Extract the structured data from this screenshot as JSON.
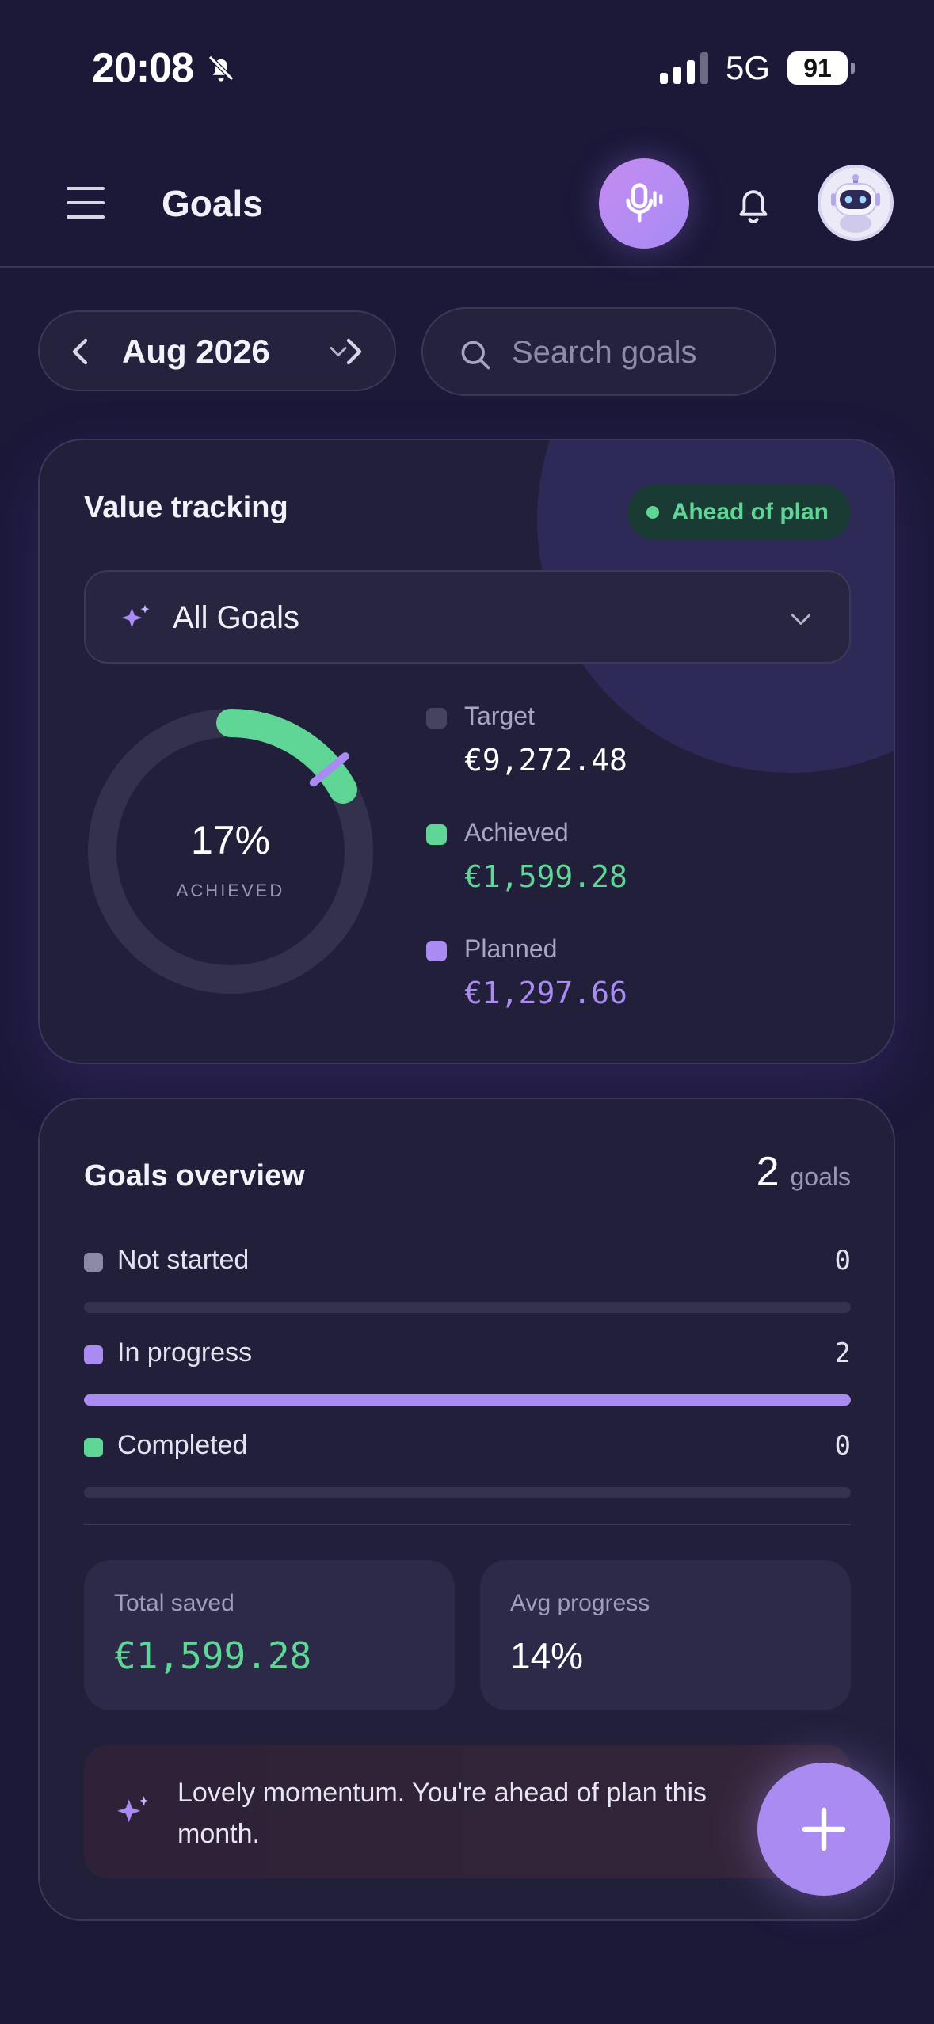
{
  "status_bar": {
    "time": "20:08",
    "network": "5G",
    "battery": "91"
  },
  "header": {
    "title": "Goals"
  },
  "controls": {
    "month": "Aug 2026",
    "search_placeholder": "Search goals"
  },
  "value_tracking": {
    "title": "Value tracking",
    "badge": "Ahead of plan",
    "goal_selector": "All Goals",
    "donut": {
      "percent_label": "17%",
      "sub_label": "ACHIEVED",
      "achieved_fraction": 0.17,
      "planned_fraction": 0.14
    },
    "legend": [
      {
        "label": "Target",
        "value": "€9,272.48",
        "color": "#45435f",
        "value_color": "#ffffff"
      },
      {
        "label": "Achieved",
        "value": "€1,599.28",
        "color": "#5fd596",
        "value_color": "#5fd596"
      },
      {
        "label": "Planned",
        "value": "€1,297.66",
        "color": "#a98bf2",
        "value_color": "#a98bf2"
      }
    ]
  },
  "overview": {
    "title": "Goals overview",
    "count": "2",
    "count_unit": "goals",
    "statuses": [
      {
        "label": "Not started",
        "count": "0",
        "color": "#8b89a3",
        "fill_fraction": 0
      },
      {
        "label": "In progress",
        "count": "2",
        "color": "#a98bf2",
        "fill_fraction": 1
      },
      {
        "label": "Completed",
        "count": "0",
        "color": "#5fd596",
        "fill_fraction": 0
      }
    ],
    "total_saved_label": "Total saved",
    "total_saved_value": "€1,599.28",
    "avg_progress_label": "Avg progress",
    "avg_progress_value": "14%",
    "note": "Lovely momentum. You're ahead of plan this month."
  },
  "colors": {
    "background": "#1b1838",
    "card": "#211f3a",
    "accent": "#a98bf2",
    "success": "#5fd596"
  }
}
